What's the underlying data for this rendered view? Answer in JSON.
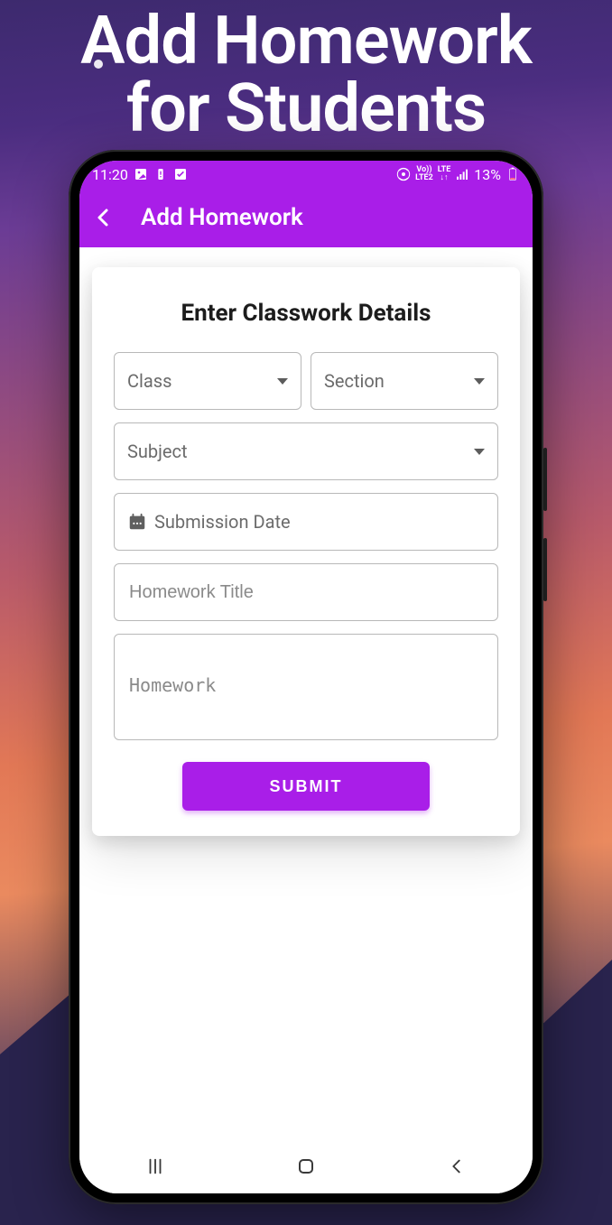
{
  "promo": {
    "title_line1": "Add Homework",
    "title_line2": "for Students"
  },
  "status": {
    "time": "11:20",
    "battery_label": "13%"
  },
  "appbar": {
    "title": "Add Homework"
  },
  "form": {
    "heading": "Enter Classwork Details",
    "class_label": "Class",
    "section_label": "Section",
    "subject_label": "Subject",
    "submission_label": "Submission Date",
    "title_placeholder": "Homework Title",
    "body_placeholder": "Homework",
    "submit_label": "SUBMIT"
  }
}
